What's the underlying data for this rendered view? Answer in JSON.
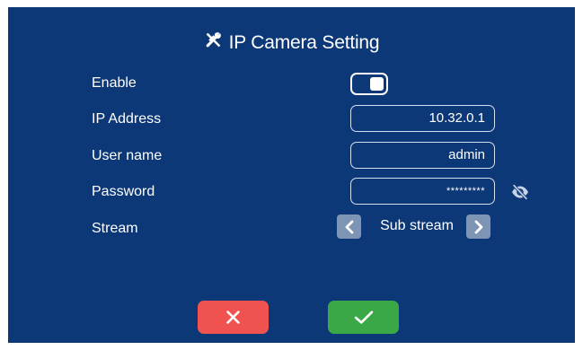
{
  "title": "IP Camera Setting",
  "title_icon": "tools-icon",
  "fields": {
    "enable_label": "Enable",
    "enable_on": true,
    "ip_label": "IP Address",
    "ip_value": "10.32.0.1",
    "user_label": "User name",
    "user_value": "admin",
    "password_label": "Password",
    "password_value": "*********",
    "stream_label": "Stream",
    "stream_value": "Sub stream"
  },
  "icons": {
    "password_visibility": "eye-slash-icon",
    "stream_prev": "chevron-left-icon",
    "stream_next": "chevron-right-icon",
    "cancel": "close-icon",
    "confirm": "check-icon"
  },
  "colors": {
    "background": "#0d3878",
    "cancel": "#f0534f",
    "confirm": "#3aa846",
    "stepper": "#7e94b4"
  }
}
